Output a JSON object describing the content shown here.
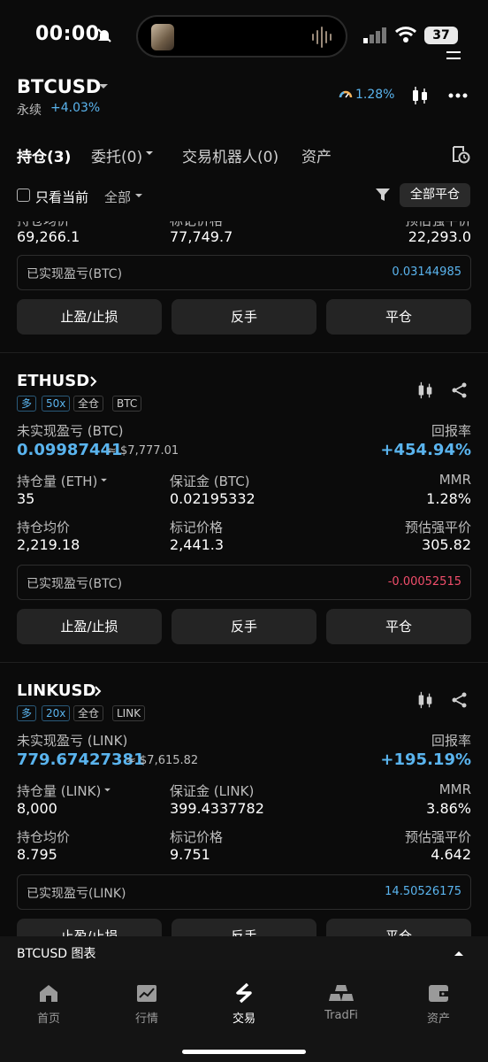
{
  "status_bar": {
    "time": "00:00",
    "battery": "37"
  },
  "header": {
    "symbol": "BTCUSD",
    "perp_label": "永续",
    "change": "+4.03%",
    "indicator_pct": "1.28%"
  },
  "tabs": [
    {
      "label": "持仓(3)"
    },
    {
      "label": "委托(0)"
    },
    {
      "label": "交易机器人(0)"
    },
    {
      "label": "资产"
    }
  ],
  "filter": {
    "only_current": "只看当前",
    "all": "全部",
    "close_all": "全部平仓"
  },
  "position_btc_partial": {
    "labels": {
      "avg_price": "持仓均价",
      "mark_price": "标记价格",
      "est_liq": "预估强平价"
    },
    "avg_price": "69,266.1",
    "mark_price": "77,749.7",
    "est_liq": "22,293.0",
    "realized_label": "已实现盈亏(BTC)",
    "realized_value": "0.03144985",
    "buttons": [
      "止盈/止损",
      "反手",
      "平仓"
    ]
  },
  "position_eth": {
    "symbol": "ETHUSD",
    "tags": [
      "多",
      "50x",
      "全仓",
      "BTC"
    ],
    "unrealized_label": "未实现盈亏 (BTC)",
    "unrealized_value": "0.09987441",
    "unrealized_usd": "≈ $7,777.01",
    "roe_label": "回报率",
    "roe_value": "+454.94%",
    "qty_label": "持仓量 (ETH)",
    "qty_value": "35",
    "margin_label": "保证金 (BTC)",
    "margin_value": "0.02195332",
    "mmr_label": "MMR",
    "mmr_value": "1.28%",
    "avg_price_label": "持仓均价",
    "avg_price": "2,219.18",
    "mark_price_label": "标记价格",
    "mark_price": "2,441.3",
    "est_liq_label": "预估强平价",
    "est_liq": "305.82",
    "realized_label": "已实现盈亏(BTC)",
    "realized_value": "-0.00052515",
    "buttons": [
      "止盈/止损",
      "反手",
      "平仓"
    ]
  },
  "position_link": {
    "symbol": "LINKUSD",
    "tags": [
      "多",
      "20x",
      "全仓",
      "LINK"
    ],
    "unrealized_label": "未实现盈亏 (LINK)",
    "unrealized_value": "779.67427381",
    "unrealized_usd": "≈ $7,615.82",
    "roe_label": "回报率",
    "roe_value": "+195.19%",
    "qty_label": "持仓量 (LINK)",
    "qty_value": "8,000",
    "margin_label": "保证金 (LINK)",
    "margin_value": "399.4337782",
    "mmr_label": "MMR",
    "mmr_value": "3.86%",
    "avg_price_label": "持仓均价",
    "avg_price": "8.795",
    "mark_price_label": "标记价格",
    "mark_price": "9.751",
    "est_liq_label": "预估强平价",
    "est_liq": "4.642",
    "realized_label": "已实现盈亏(LINK)",
    "realized_value": "14.50526175",
    "buttons": [
      "止盈/止损",
      "反手",
      "平仓"
    ]
  },
  "chart_strip": {
    "label": "BTCUSD  图表"
  },
  "bottom_nav": [
    {
      "label": "首页",
      "icon": "home-icon"
    },
    {
      "label": "行情",
      "icon": "market-icon"
    },
    {
      "label": "交易",
      "icon": "trade-icon"
    },
    {
      "label": "TradFi",
      "icon": "tradfi-icon"
    },
    {
      "label": "资产",
      "icon": "wallet-icon"
    }
  ],
  "colors": {
    "accent_blue": "#5ab4ee",
    "orange": "#f3b25c",
    "red": "#f04e6b",
    "background": "#0b0b0b"
  }
}
